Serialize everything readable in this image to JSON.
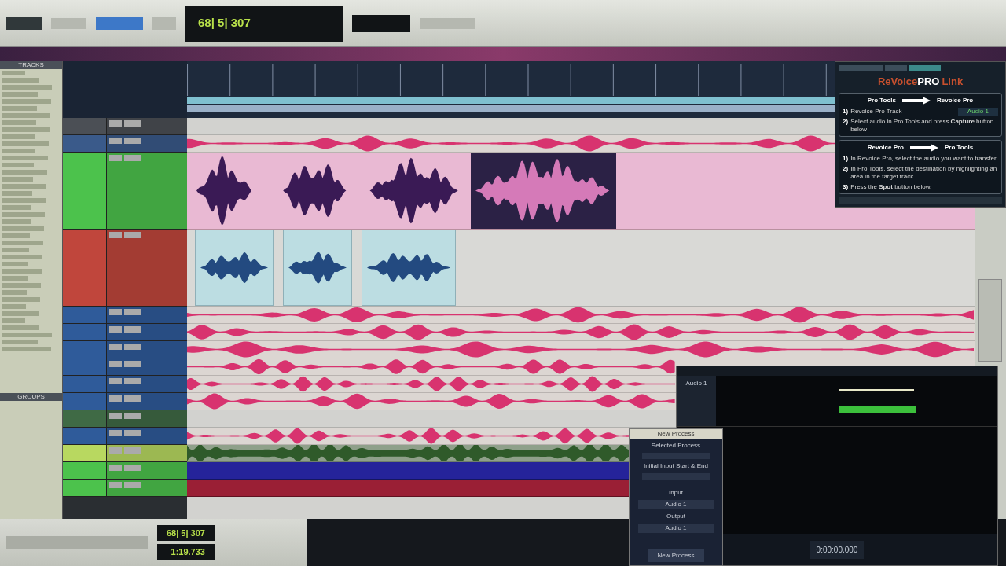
{
  "toolbar": {
    "main_counter": "68| 5| 307"
  },
  "sidebar": {
    "tracks_header": "TRACKS",
    "groups_header": "GROUPS"
  },
  "tracks": [
    {
      "kind": "empty",
      "color": "#4b4f55"
    },
    {
      "kind": "wave",
      "color": "#3a5a8a"
    },
    {
      "kind": "vocal",
      "color": "#4cc24c"
    },
    {
      "kind": "clips",
      "color": "#c0463c"
    },
    {
      "kind": "wave",
      "color": "#2f5b9a"
    },
    {
      "kind": "wave",
      "color": "#2f5b9a"
    },
    {
      "kind": "wave",
      "color": "#2f5b9a"
    },
    {
      "kind": "wave",
      "color": "#2f5b9a"
    },
    {
      "kind": "wave",
      "color": "#2f5b9a"
    },
    {
      "kind": "wave",
      "color": "#2f5b9a"
    },
    {
      "kind": "empty",
      "color": "#3f6a45"
    },
    {
      "kind": "wave",
      "color": "#2f5b9a"
    },
    {
      "kind": "green-wave",
      "color": "#b8d860"
    },
    {
      "kind": "blue-bar",
      "color": "#4cc24c"
    },
    {
      "kind": "red-bar",
      "color": "#4cc24c"
    }
  ],
  "revoice_link": {
    "logo_left": "ReVoice",
    "logo_mid": "PRO",
    "logo_right": "Link",
    "sections": [
      {
        "from": "Pro Tools",
        "to": "Revoice Pro",
        "steps": [
          {
            "num": "1)",
            "text": "Revoice Pro Track",
            "field": "Audio 1"
          },
          {
            "num": "2)",
            "text": "Select audio in Pro Tools and press **Capture** button below"
          }
        ]
      },
      {
        "from": "Revoice Pro",
        "to": "Pro Tools",
        "steps": [
          {
            "num": "1)",
            "text": "In Revoice Pro, select the audio you want to transfer."
          },
          {
            "num": "2)",
            "text": "In Pro Tools, select the destination by highlighting an area in the target track."
          },
          {
            "num": "3)",
            "text": "Press the **Spot** button below."
          }
        ]
      }
    ]
  },
  "revoice": {
    "track_name": "Audio 1",
    "timecode": "0:00:00.000"
  },
  "new_process": {
    "title": "New Process",
    "selected_process_label": "Selected Process",
    "initial_label": "Initial Input Start & End",
    "input_label": "Input",
    "input_value": "Audio 1",
    "output_label": "Output",
    "output_value": "Audio 1",
    "button": "New Process"
  },
  "transport": {
    "main_counter": "68| 5| 307",
    "sub_counter": "1:19.733"
  }
}
